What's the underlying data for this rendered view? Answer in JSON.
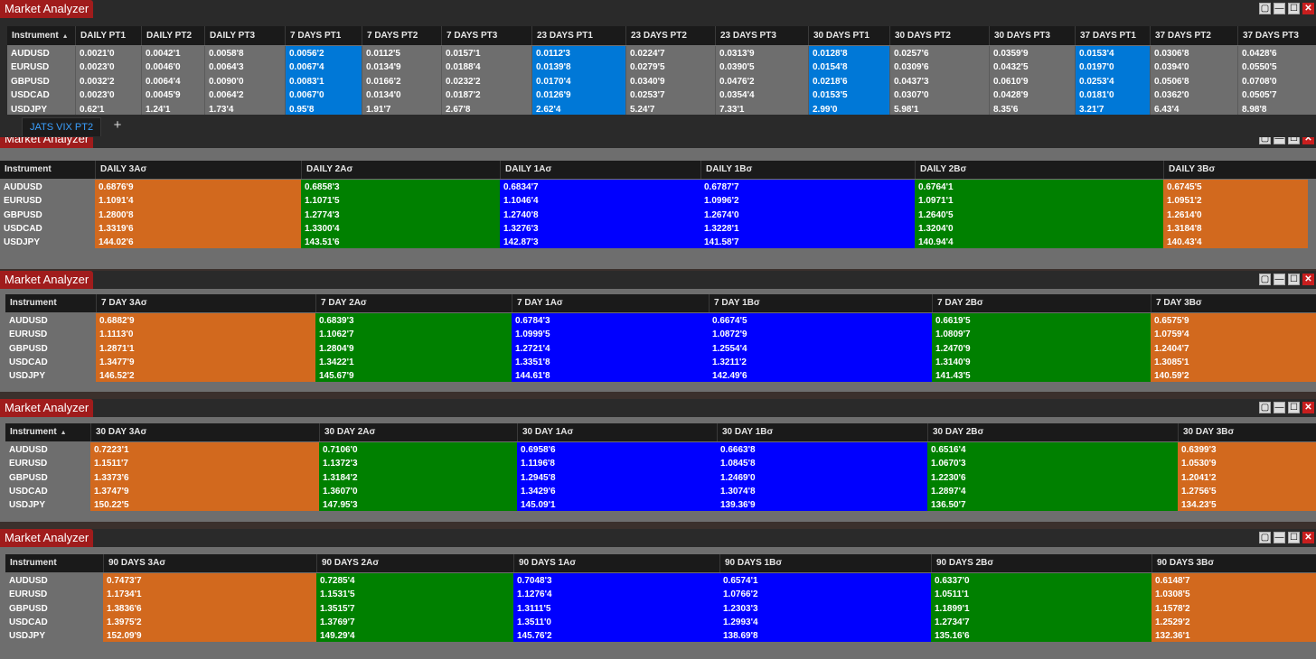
{
  "colors": {
    "orange": "#d2691e",
    "green": "#008000",
    "blue": "#0000ff",
    "lightblue": "#0078d7",
    "gray": "#6e6e6e",
    "title_red": "#a01c1c"
  },
  "window_title": "Market Analyzer",
  "window_buttons": [
    "▢",
    "—",
    "☐",
    "✕"
  ],
  "sort_indicator": "▲",
  "instruments": [
    "AUDUSD",
    "EURUSD",
    "GBPUSD",
    "USDCAD",
    "USDJPY"
  ],
  "top_panel": {
    "headers": [
      "Instrument",
      "DAILY PT1",
      "DAILY PT2",
      "DAILY PT3",
      "7 DAYS PT1",
      "7 DAYS PT2",
      "7 DAYS PT3",
      "23 DAYS PT1",
      "23 DAYS PT2",
      "23 DAYS PT3",
      "30 DAYS PT1",
      "30 DAYS PT2",
      "30 DAYS PT3",
      "37 DAYS PT1",
      "37 DAYS PT2",
      "37 DAYS PT3"
    ],
    "columns": [
      [
        "0.0021'0",
        "0.0023'0",
        "0.0032'2",
        "0.0023'0",
        "0.62'1"
      ],
      [
        "0.0042'1",
        "0.0046'0",
        "0.0064'4",
        "0.0045'9",
        "1.24'1"
      ],
      [
        "0.0058'8",
        "0.0064'3",
        "0.0090'0",
        "0.0064'2",
        "1.73'4"
      ],
      [
        "0.0056'2",
        "0.0067'4",
        "0.0083'1",
        "0.0067'0",
        "0.95'8"
      ],
      [
        "0.0112'5",
        "0.0134'9",
        "0.0166'2",
        "0.0134'0",
        "1.91'7"
      ],
      [
        "0.0157'1",
        "0.0188'4",
        "0.0232'2",
        "0.0187'2",
        "2.67'8"
      ],
      [
        "0.0112'3",
        "0.0139'8",
        "0.0170'4",
        "0.0126'9",
        "2.62'4"
      ],
      [
        "0.0224'7",
        "0.0279'5",
        "0.0340'9",
        "0.0253'7",
        "5.24'7"
      ],
      [
        "0.0313'9",
        "0.0390'5",
        "0.0476'2",
        "0.0354'4",
        "7.33'1"
      ],
      [
        "0.0128'8",
        "0.0154'8",
        "0.0218'6",
        "0.0153'5",
        "2.99'0"
      ],
      [
        "0.0257'6",
        "0.0309'6",
        "0.0437'3",
        "0.0307'0",
        "5.98'1"
      ],
      [
        "0.0359'9",
        "0.0432'5",
        "0.0610'9",
        "0.0428'9",
        "8.35'6"
      ],
      [
        "0.0153'4",
        "0.0197'0",
        "0.0253'4",
        "0.0181'0",
        "3.21'7"
      ],
      [
        "0.0306'8",
        "0.0394'0",
        "0.0506'8",
        "0.0362'0",
        "6.43'4"
      ],
      [
        "0.0428'6",
        "0.0550'5",
        "0.0708'0",
        "0.0505'7",
        "8.98'8"
      ]
    ],
    "tab_label": "JATS VIX PT2",
    "tab_add": "+"
  },
  "panels": [
    {
      "headers": [
        "Instrument",
        "DAILY 3Aσ",
        "DAILY 2Aσ",
        "DAILY 1Aσ",
        "DAILY 1Bσ",
        "DAILY 2Bσ",
        "DAILY 3Bσ"
      ],
      "columns": [
        [
          "0.6876'9",
          "1.1091'4",
          "1.2800'8",
          "1.3319'6",
          "144.02'6"
        ],
        [
          "0.6858'3",
          "1.1071'5",
          "1.2774'3",
          "1.3300'4",
          "143.51'6"
        ],
        [
          "0.6834'7",
          "1.1046'4",
          "1.2740'8",
          "1.3276'3",
          "142.87'3"
        ],
        [
          "0.6787'7",
          "1.0996'2",
          "1.2674'0",
          "1.3228'1",
          "141.58'7"
        ],
        [
          "0.6764'1",
          "1.0971'1",
          "1.2640'5",
          "1.3204'0",
          "140.94'4"
        ],
        [
          "0.6745'5",
          "1.0951'2",
          "1.2614'0",
          "1.3184'8",
          "140.43'4"
        ]
      ]
    },
    {
      "headers": [
        "Instrument",
        "7 DAY 3Aσ",
        "7 DAY 2Aσ",
        "7 DAY 1Aσ",
        "7 DAY 1Bσ",
        "7 DAY 2Bσ",
        "7 DAY 3Bσ"
      ],
      "columns": [
        [
          "0.6882'9",
          "1.1113'0",
          "1.2871'1",
          "1.3477'9",
          "146.52'2"
        ],
        [
          "0.6839'3",
          "1.1062'7",
          "1.2804'9",
          "1.3422'1",
          "145.67'9"
        ],
        [
          "0.6784'3",
          "1.0999'5",
          "1.2721'4",
          "1.3351'8",
          "144.61'8"
        ],
        [
          "0.6674'5",
          "1.0872'9",
          "1.2554'4",
          "1.3211'2",
          "142.49'6"
        ],
        [
          "0.6619'5",
          "1.0809'7",
          "1.2470'9",
          "1.3140'9",
          "141.43'5"
        ],
        [
          "0.6575'9",
          "1.0759'4",
          "1.2404'7",
          "1.3085'1",
          "140.59'2"
        ]
      ]
    },
    {
      "headers": [
        "Instrument",
        "30 DAY 3Aσ",
        "30 DAY 2Aσ",
        "30 DAY 1Aσ",
        "30 DAY 1Bσ",
        "30 DAY 2Bσ",
        "30 DAY 3Bσ"
      ],
      "columns": [
        [
          "0.7223'1",
          "1.1511'7",
          "1.3373'6",
          "1.3747'9",
          "150.22'5"
        ],
        [
          "0.7106'0",
          "1.1372'3",
          "1.3184'2",
          "1.3607'0",
          "147.95'3"
        ],
        [
          "0.6958'6",
          "1.1196'8",
          "1.2945'8",
          "1.3429'6",
          "145.09'1"
        ],
        [
          "0.6663'8",
          "1.0845'8",
          "1.2469'0",
          "1.3074'8",
          "139.36'9"
        ],
        [
          "0.6516'4",
          "1.0670'3",
          "1.2230'6",
          "1.2897'4",
          "136.50'7"
        ],
        [
          "0.6399'3",
          "1.0530'9",
          "1.2041'2",
          "1.2756'5",
          "134.23'5"
        ]
      ]
    },
    {
      "headers": [
        "Instrument",
        "90 DAYS 3Aσ",
        "90 DAYS 2Aσ",
        "90 DAYS 1Aσ",
        "90 DAYS 1Bσ",
        "90 DAYS 2Bσ",
        "90 DAYS 3Bσ"
      ],
      "columns": [
        [
          "0.7473'7",
          "1.1734'1",
          "1.3836'6",
          "1.3975'2",
          "152.09'9"
        ],
        [
          "0.7285'4",
          "1.1531'5",
          "1.3515'7",
          "1.3769'7",
          "149.29'4"
        ],
        [
          "0.7048'3",
          "1.1276'4",
          "1.3111'5",
          "1.3511'0",
          "145.76'2"
        ],
        [
          "0.6574'1",
          "1.0766'2",
          "1.2303'3",
          "1.2993'4",
          "138.69'8"
        ],
        [
          "0.6337'0",
          "1.0511'1",
          "1.1899'1",
          "1.2734'7",
          "135.16'6"
        ],
        [
          "0.6148'7",
          "1.0308'5",
          "1.1578'2",
          "1.2529'2",
          "132.36'1"
        ]
      ]
    }
  ]
}
